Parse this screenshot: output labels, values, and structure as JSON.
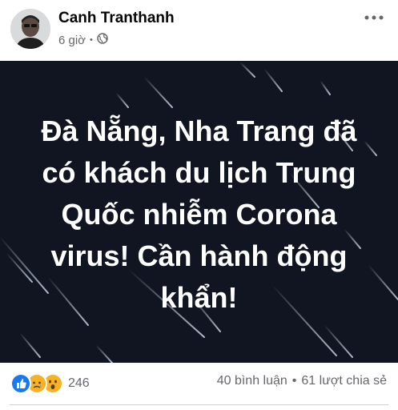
{
  "post": {
    "author": "Canh Tranthanh",
    "time": "6 giờ",
    "separator": "•",
    "privacy_icon": "globe-icon",
    "more_icon": "more-dots-icon",
    "image_text": [
      "Đà Nẵng, Nha Trang đã",
      "có khách du lịch Trung",
      "Quốc nhiễm Corona",
      "virus! Cần hành động",
      "khẩn!"
    ]
  },
  "reactions": {
    "icons": [
      "like-icon",
      "sad-icon",
      "wow-icon"
    ],
    "count": "246"
  },
  "stats": {
    "comments": "40 bình luận",
    "separator": "•",
    "shares": "61 lượt chia sẻ"
  },
  "colors": {
    "image_bg": "#101521",
    "like": "#1877f2",
    "reaction_yellow": "#f7b125"
  }
}
